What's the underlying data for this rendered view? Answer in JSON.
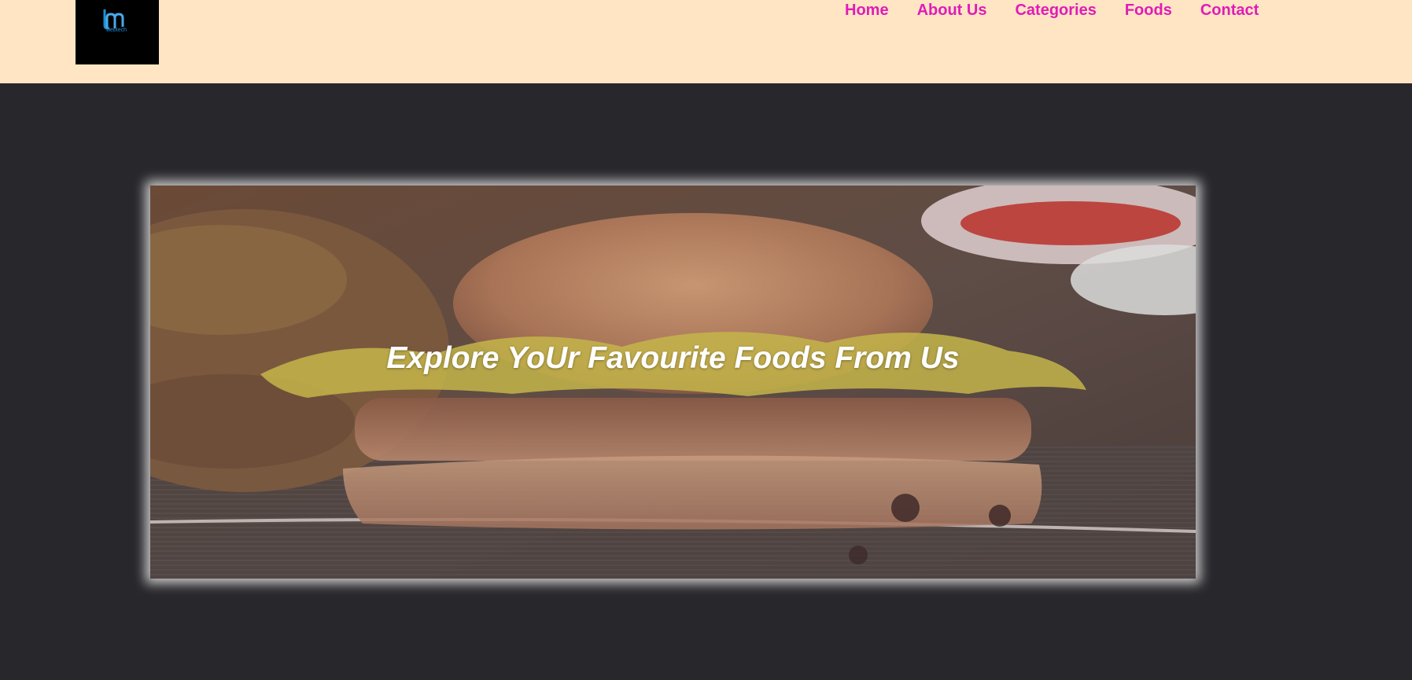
{
  "logo": {
    "text": "webtech",
    "mark": "tm"
  },
  "nav": {
    "items": [
      "Home",
      "About Us",
      "Categories",
      "Foods",
      "Contact"
    ]
  },
  "hero": {
    "title": "Explore YoUr Favourite Foods From Us",
    "image": "burger-and-biryani-photo"
  },
  "colors": {
    "header_bg": "#ffe5c4",
    "nav_link": "#e01cb7",
    "page_bg": "#28272b",
    "logo_bg": "#000000",
    "logo_accent": "#1e90d6"
  }
}
